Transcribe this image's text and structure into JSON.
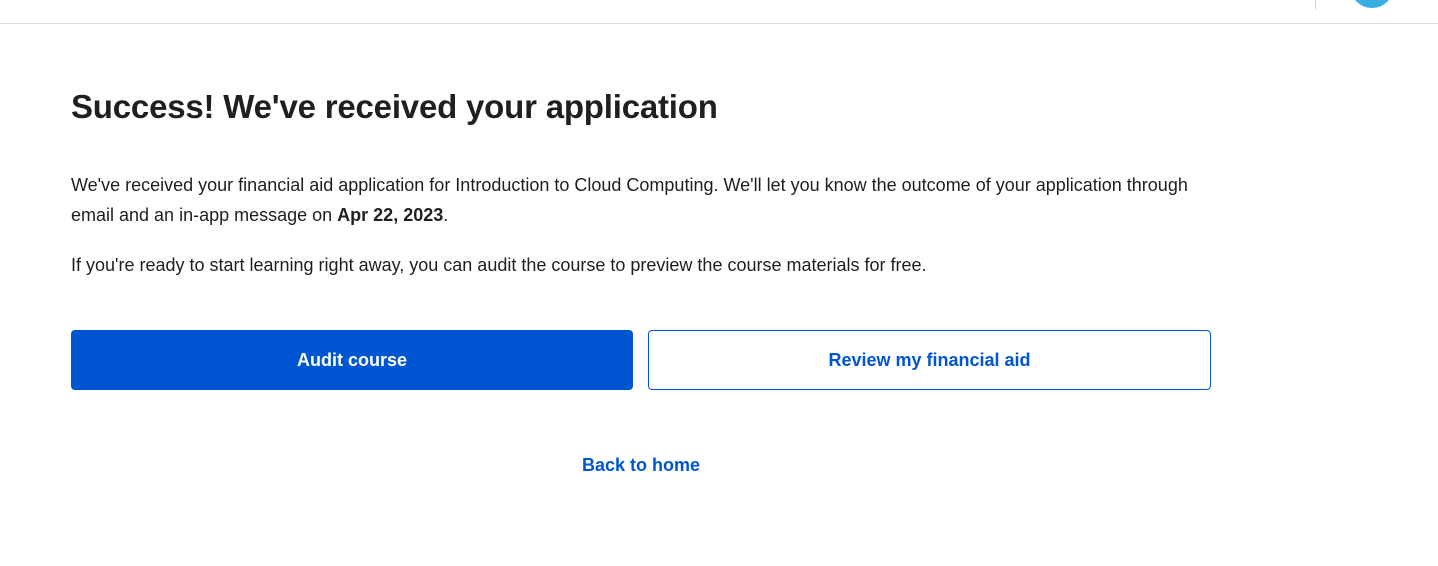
{
  "header": {
    "avatar_color": "#3aaee0"
  },
  "main": {
    "title": "Success! We've received your application",
    "paragraph1": {
      "text_before": "We've received your financial aid application for Introduction to Cloud Computing. We'll let you know the outcome of your application through email and an in-app message on ",
      "date": "Apr 22, 2023",
      "text_after": "."
    },
    "paragraph2": "If you're ready to start learning right away, you can audit the course to preview the course materials for free.",
    "buttons": {
      "audit_label": "Audit course",
      "review_label": "Review my financial aid"
    },
    "back_link_label": "Back to home"
  },
  "colors": {
    "primary": "#0056d2",
    "text": "#1f1f1f",
    "divider": "#dcdcdc"
  }
}
